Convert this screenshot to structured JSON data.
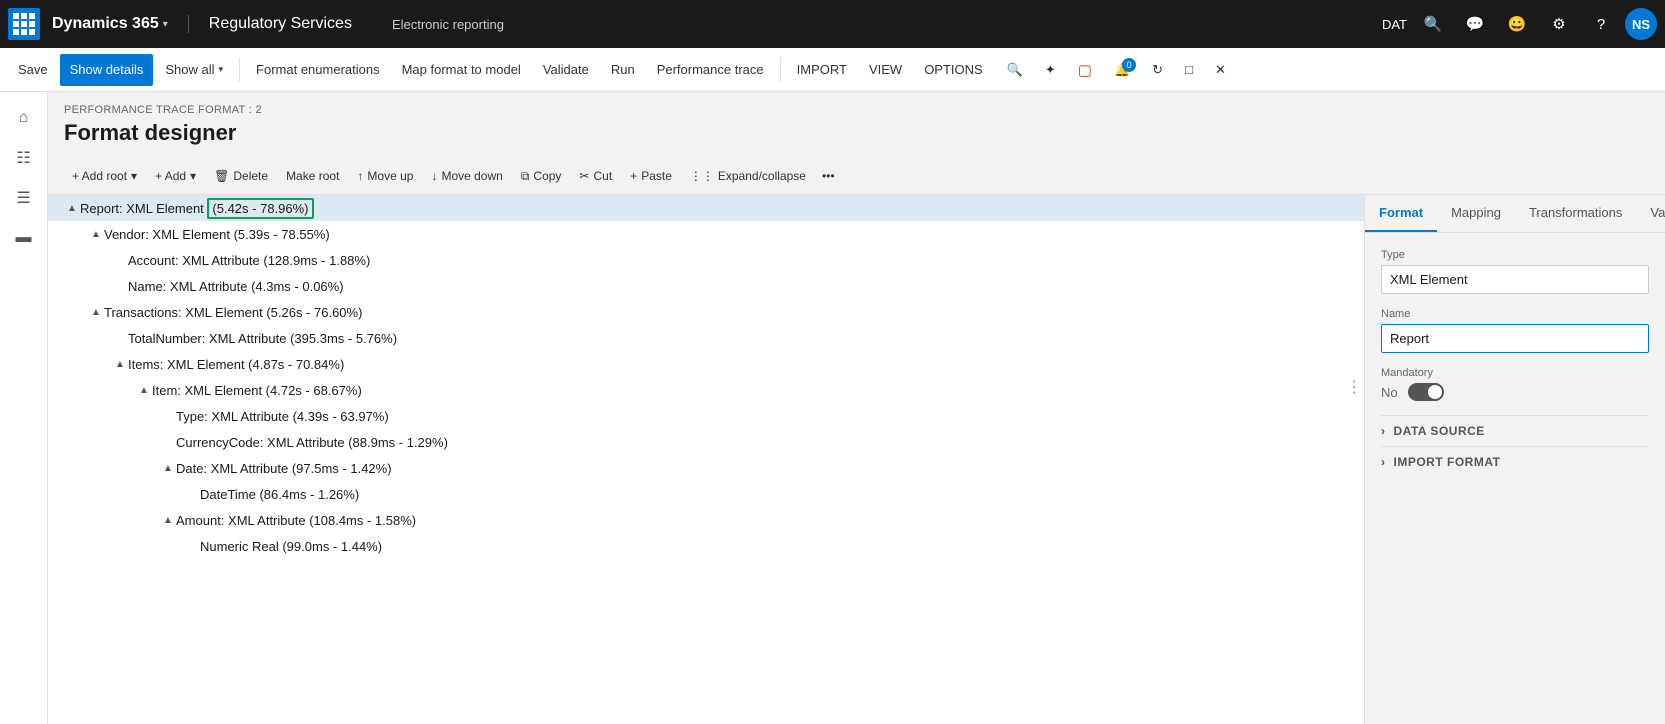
{
  "topNav": {
    "appIcon": "grid",
    "dynamics": "Dynamics 365",
    "regServices": "Regulatory Services",
    "erLabel": "Electronic reporting",
    "datLabel": "DAT",
    "avatarText": "NS"
  },
  "commandBar": {
    "save": "Save",
    "showDetails": "Show details",
    "showAll": "Show all",
    "formatEnumerations": "Format enumerations",
    "mapFormatToModel": "Map format to model",
    "validate": "Validate",
    "run": "Run",
    "performanceTrace": "Performance trace",
    "import": "IMPORT",
    "view": "VIEW",
    "options": "OPTIONS"
  },
  "breadcrumb": "PERFORMANCE TRACE FORMAT : 2",
  "pageTitle": "Format designer",
  "formatToolbar": {
    "addRoot": "+ Add root",
    "add": "+ Add",
    "delete": "Delete",
    "makeRoot": "Make root",
    "moveUp": "Move up",
    "moveDown": "Move down",
    "copy": "Copy",
    "cut": "Cut",
    "paste": "Paste",
    "expandCollapse": "Expand/collapse"
  },
  "tree": {
    "items": [
      {
        "id": 1,
        "indent": 0,
        "toggle": "▲",
        "text": "Report: XML Element (5.42s - 78.96%)",
        "selected": true,
        "highlight": true
      },
      {
        "id": 2,
        "indent": 1,
        "toggle": "▲",
        "text": "Vendor: XML Element (5.39s - 78.55%)",
        "selected": false
      },
      {
        "id": 3,
        "indent": 2,
        "toggle": "",
        "text": "Account: XML Attribute (128.9ms - 1.88%)",
        "selected": false
      },
      {
        "id": 4,
        "indent": 2,
        "toggle": "",
        "text": "Name: XML Attribute (4.3ms - 0.06%)",
        "selected": false
      },
      {
        "id": 5,
        "indent": 1,
        "toggle": "▲",
        "text": "Transactions: XML Element (5.26s - 76.60%)",
        "selected": false
      },
      {
        "id": 6,
        "indent": 2,
        "toggle": "",
        "text": "TotalNumber: XML Attribute (395.3ms - 5.76%)",
        "selected": false
      },
      {
        "id": 7,
        "indent": 2,
        "toggle": "▲",
        "text": "Items: XML Element (4.87s - 70.84%)",
        "selected": false
      },
      {
        "id": 8,
        "indent": 3,
        "toggle": "▲",
        "text": "Item: XML Element (4.72s - 68.67%)",
        "selected": false
      },
      {
        "id": 9,
        "indent": 4,
        "toggle": "",
        "text": "Type: XML Attribute (4.39s - 63.97%)",
        "selected": false
      },
      {
        "id": 10,
        "indent": 4,
        "toggle": "",
        "text": "CurrencyCode: XML Attribute (88.9ms - 1.29%)",
        "selected": false
      },
      {
        "id": 11,
        "indent": 4,
        "toggle": "▲",
        "text": "Date: XML Attribute (97.5ms - 1.42%)",
        "selected": false
      },
      {
        "id": 12,
        "indent": 5,
        "toggle": "",
        "text": "DateTime (86.4ms - 1.26%)",
        "selected": false
      },
      {
        "id": 13,
        "indent": 4,
        "toggle": "▲",
        "text": "Amount: XML Attribute (108.4ms - 1.58%)",
        "selected": false
      },
      {
        "id": 14,
        "indent": 5,
        "toggle": "",
        "text": "Numeric Real (99.0ms - 1.44%)",
        "selected": false
      }
    ]
  },
  "props": {
    "tabs": [
      "Format",
      "Mapping",
      "Transformations",
      "Validations"
    ],
    "activeTab": "Format",
    "typeLabel": "Type",
    "typeValue": "XML Element",
    "nameLabel": "Name",
    "nameValue": "Report",
    "mandatoryLabel": "Mandatory",
    "mandatoryNo": "No",
    "dataSourceSection": "DATA SOURCE",
    "importFormatSection": "IMPORT FORMAT"
  }
}
